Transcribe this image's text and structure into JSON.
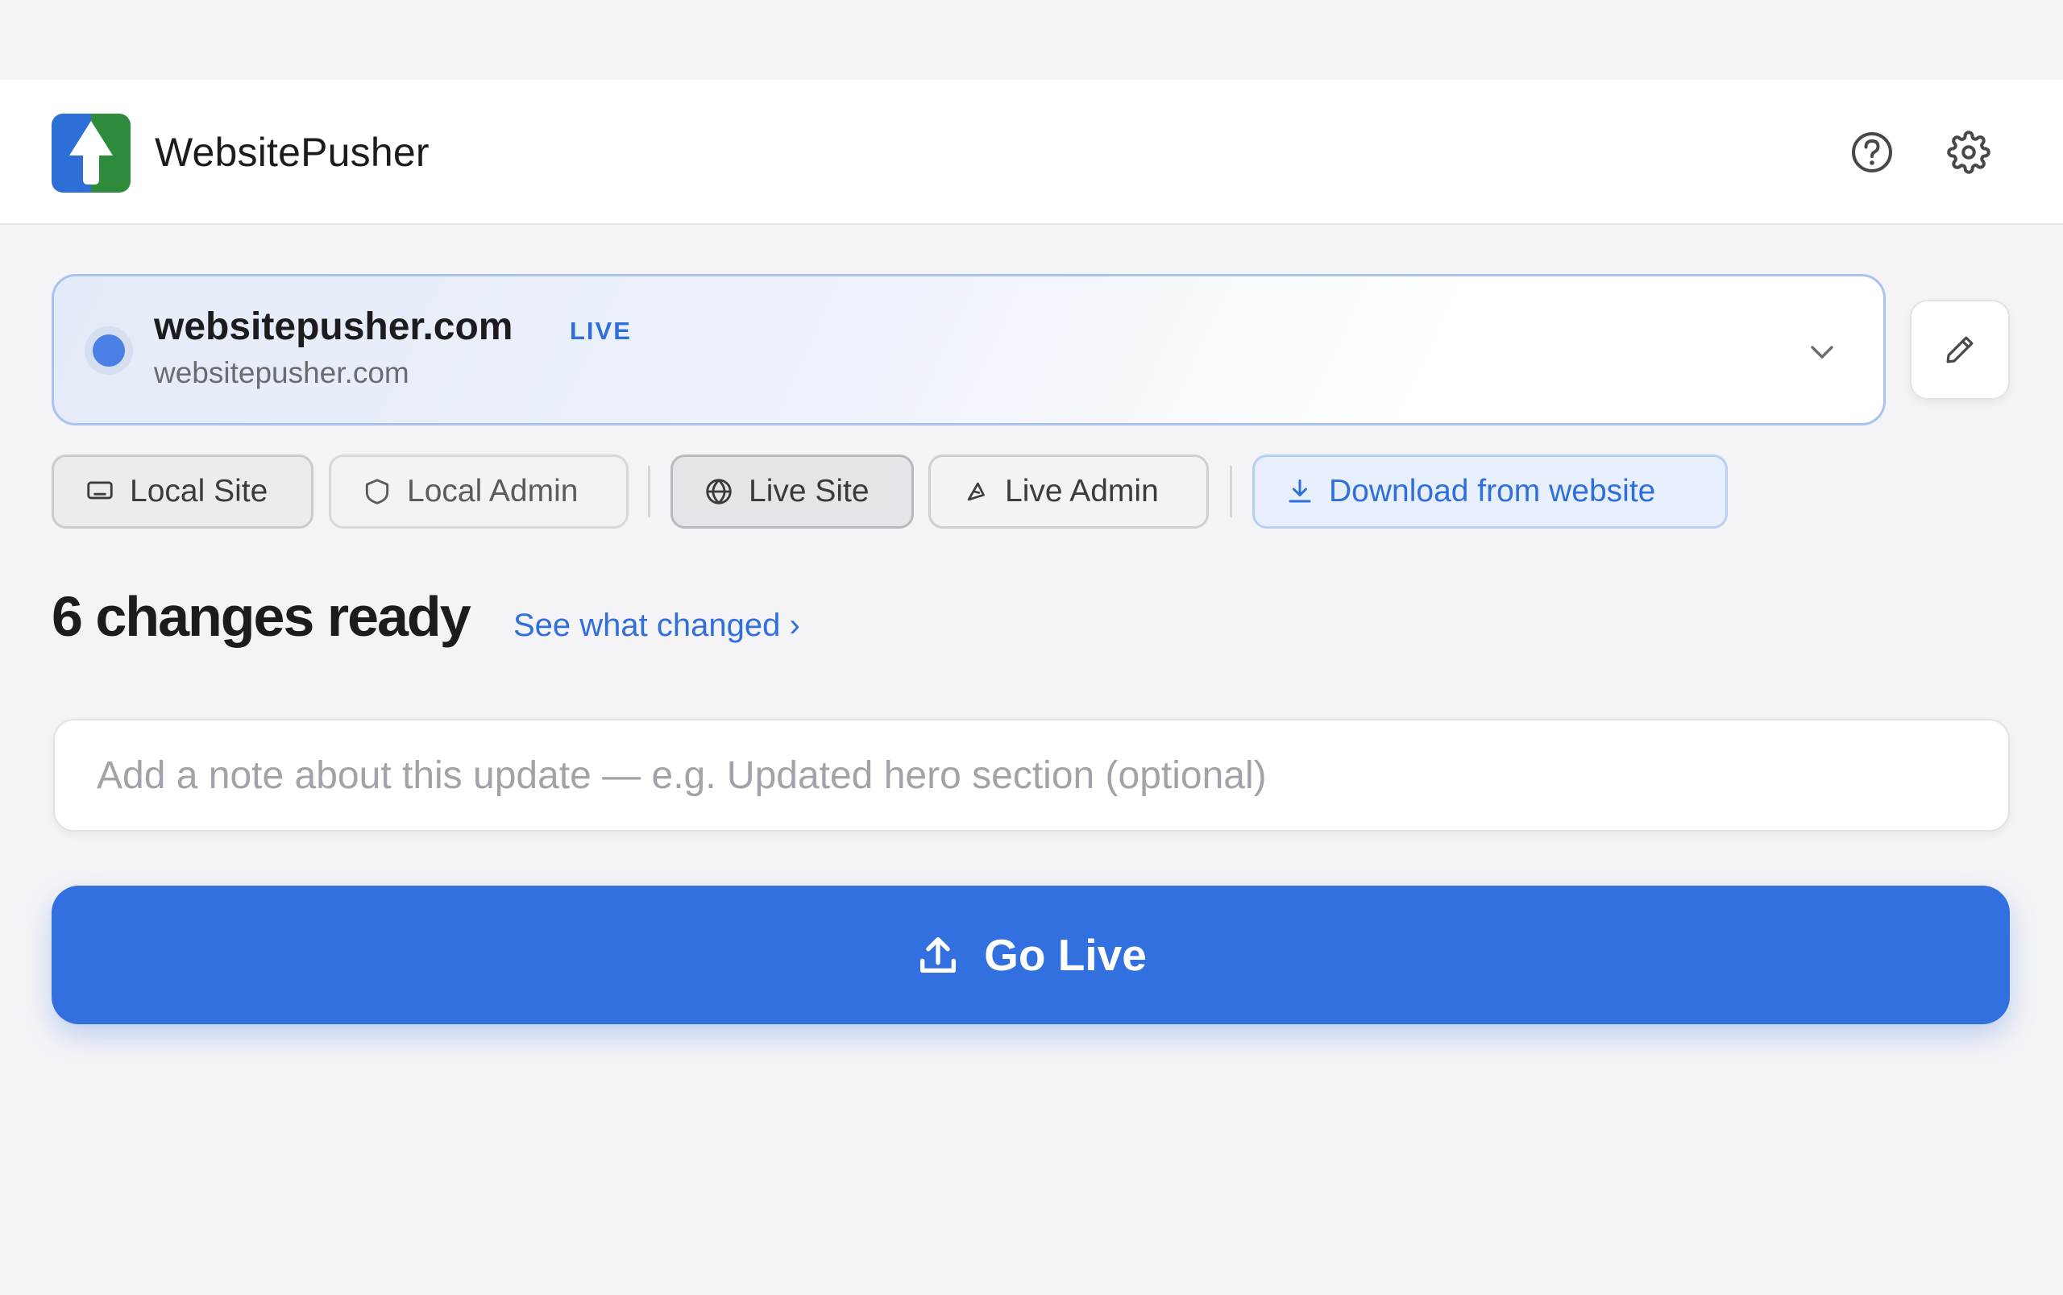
{
  "header": {
    "app_title": "WebsitePusher",
    "logo_icon": "upload-arrow-icon",
    "help_icon": "help-circle-icon",
    "settings_icon": "gear-icon"
  },
  "site": {
    "name": "websitepusher.com",
    "status": "LIVE",
    "url": "websitepusher.com",
    "status_color": "#4a7fe6"
  },
  "quick_links": [
    {
      "label": "Local Site",
      "icon": "monitor-icon"
    },
    {
      "label": "Local Admin",
      "icon": "shield-icon"
    },
    {
      "label": "Live Site",
      "icon": "globe-icon"
    },
    {
      "label": "Live Admin",
      "icon": "pen-nib-icon"
    },
    {
      "label": "Download from website",
      "icon": "download-icon"
    }
  ],
  "changes": {
    "title": "6 changes ready",
    "link": "See what changed ›"
  },
  "note": {
    "placeholder": "Add a note about this update — e.g. Updated hero section (optional)",
    "value": ""
  },
  "go_live": {
    "label": "Go Live",
    "color": "#3170de"
  },
  "colors": {
    "accent": "#2f6fdc",
    "logo_blue": "#2d6fd6",
    "logo_green": "#2e8b3c"
  }
}
